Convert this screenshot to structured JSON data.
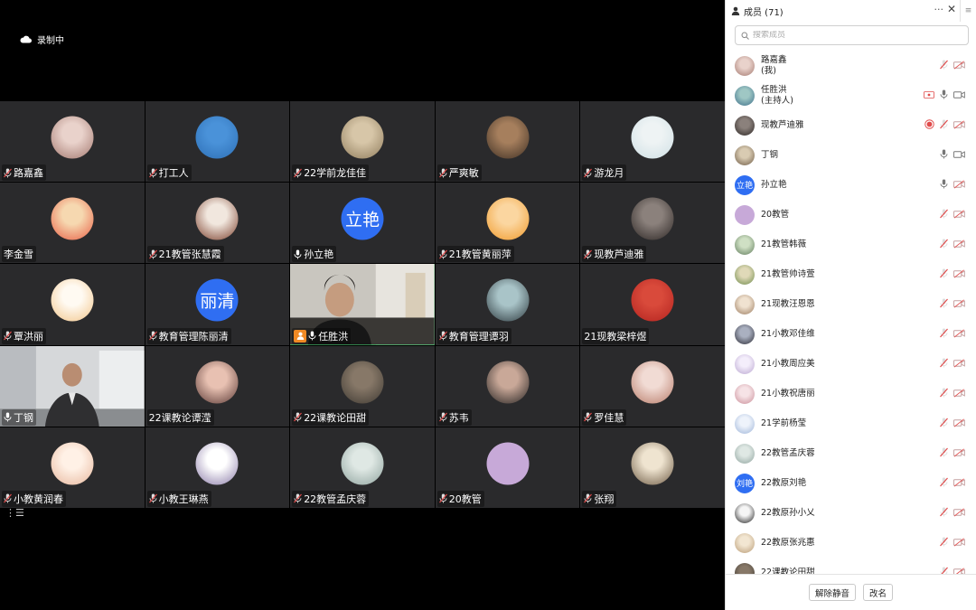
{
  "recording_label": "录制中",
  "grid_tiles": [
    {
      "name": "路嘉鑫",
      "mic": "muted",
      "avatar": {
        "colors": [
          "#a3786f",
          "#e9d2cb"
        ]
      }
    },
    {
      "name": "打工人",
      "mic": "muted",
      "avatar": {
        "colors": [
          "#2d6fb5",
          "#4a92d9"
        ]
      }
    },
    {
      "name": "22学前龙佳佳",
      "mic": "muted",
      "avatar": {
        "colors": [
          "#8f7c5c",
          "#d7c6a8"
        ]
      }
    },
    {
      "name": "严爽敏",
      "mic": "muted",
      "avatar": {
        "colors": [
          "#3f3024",
          "#a67f5d"
        ]
      }
    },
    {
      "name": "游龙月",
      "mic": "muted",
      "avatar": {
        "colors": [
          "#cfe0e5",
          "#eef3f4"
        ]
      }
    },
    {
      "name": "李金雪",
      "mic": "none",
      "avatar": {
        "colors": [
          "#e85f45",
          "#f6d8b0"
        ]
      }
    },
    {
      "name": "21教管张慧霞",
      "mic": "muted",
      "avatar": {
        "colors": [
          "#7b3f2c",
          "#f1e7de"
        ]
      }
    },
    {
      "name": "孙立艳",
      "mic": "on",
      "avatar": {
        "text": "立艳"
      }
    },
    {
      "name": "21教管黄丽萍",
      "mic": "muted",
      "avatar": {
        "colors": [
          "#f09a2b",
          "#fbd6a0"
        ]
      }
    },
    {
      "name": "现教芦迪雅",
      "mic": "muted",
      "avatar": {
        "colors": [
          "#2c2624",
          "#8b817c"
        ]
      }
    },
    {
      "name": "覃洪丽",
      "mic": "muted",
      "avatar": {
        "colors": [
          "#f2c58a",
          "#fffaf2"
        ]
      }
    },
    {
      "name": "教育管理陈丽清",
      "mic": "muted",
      "avatar": {
        "text": "丽清"
      }
    },
    {
      "name": "任胜洪",
      "mic": "on",
      "video": "host",
      "host_badge": true
    },
    {
      "name": "教育管理谭羽",
      "mic": "muted",
      "avatar": {
        "colors": [
          "#2e3a3f",
          "#a9c4c8"
        ]
      }
    },
    {
      "name": "21现教梁梓煜",
      "mic": "none",
      "avatar": {
        "colors": [
          "#b3231f",
          "#d94a3b"
        ]
      }
    },
    {
      "name": "丁钢",
      "mic": "on",
      "video": "office"
    },
    {
      "name": "22课教论谭滢",
      "mic": "none",
      "avatar": {
        "colors": [
          "#5b3a36",
          "#e8c1b2"
        ]
      }
    },
    {
      "name": "22课教论田甜",
      "mic": "muted",
      "avatar": {
        "colors": [
          "#3f3a33",
          "#877868"
        ]
      }
    },
    {
      "name": "苏韦",
      "mic": "muted",
      "avatar": {
        "colors": [
          "#262322",
          "#c9a898"
        ]
      }
    },
    {
      "name": "罗佳慧",
      "mic": "muted",
      "avatar": {
        "colors": [
          "#b87c6a",
          "#f1dbd4"
        ]
      }
    },
    {
      "name": "小教黄润春",
      "mic": "muted",
      "avatar": {
        "colors": [
          "#e7b79d",
          "#fff1e6"
        ]
      }
    },
    {
      "name": "小教王琳燕",
      "mic": "muted",
      "avatar": {
        "colors": [
          "#8a7aa8",
          "#ffffff"
        ]
      }
    },
    {
      "name": "22教管孟庆蓉",
      "mic": "muted",
      "avatar": {
        "colors": [
          "#8fa39e",
          "#dfe8e4"
        ]
      }
    },
    {
      "name": "20教管",
      "mic": "muted",
      "avatar": {
        "colors": [
          "#c7a9d8",
          "#c7a9d8"
        ]
      }
    },
    {
      "name": "张翔",
      "mic": "muted",
      "avatar": {
        "colors": [
          "#6e5b45",
          "#efe4d0"
        ]
      }
    }
  ],
  "panel": {
    "title": "成员 (71)",
    "more_label": "···",
    "close_label": "✕",
    "menu_label": "≡",
    "search_placeholder": "搜索成员",
    "footer": {
      "unmute_label": "解除静音",
      "rename_label": "改名"
    }
  },
  "members": [
    {
      "name": "路嘉鑫",
      "sub": "(我)",
      "mic": "muted",
      "video": "off",
      "avatar": {
        "colors": [
          "#a3786f",
          "#e9d2cb"
        ]
      }
    },
    {
      "name": "任胜洪",
      "sub": "(主持人)",
      "mic": "on",
      "video": "on",
      "share": true,
      "avatar": {
        "colors": [
          "#3d6f8a",
          "#9fc7c4"
        ]
      }
    },
    {
      "name": "现教芦迪雅",
      "mic": "muted",
      "video": "off",
      "record": true,
      "avatar": {
        "colors": [
          "#2c2624",
          "#8b817c"
        ]
      }
    },
    {
      "name": "丁钢",
      "mic": "on",
      "video": "on",
      "avatar": {
        "colors": [
          "#6d5a45",
          "#d9cbb2"
        ]
      }
    },
    {
      "name": "孙立艳",
      "mic": "on",
      "video": "off",
      "avatar": {
        "text": "立艳"
      }
    },
    {
      "name": "20教管",
      "mic": "muted",
      "video": "off",
      "avatar": {
        "colors": [
          "#c7a9d8",
          "#c7a9d8"
        ]
      }
    },
    {
      "name": "21教管韩薇",
      "mic": "muted",
      "video": "off",
      "avatar": {
        "colors": [
          "#5f7a5b",
          "#cfe0c4"
        ]
      }
    },
    {
      "name": "21教管帅诗萱",
      "mic": "muted",
      "video": "off",
      "avatar": {
        "colors": [
          "#6d8a4a",
          "#e0d9b8"
        ]
      }
    },
    {
      "name": "21现教汪恩恩",
      "mic": "muted",
      "video": "off",
      "avatar": {
        "colors": [
          "#9a7a5e",
          "#f0e2d0"
        ]
      }
    },
    {
      "name": "21小教邓佳维",
      "mic": "muted",
      "video": "off",
      "avatar": {
        "colors": [
          "#2a2a34",
          "#aab0c0"
        ]
      }
    },
    {
      "name": "21小教周应美",
      "mic": "muted",
      "video": "off",
      "avatar": {
        "colors": [
          "#b9a6d0",
          "#f4eefb"
        ]
      }
    },
    {
      "name": "21小教祝唐丽",
      "mic": "muted",
      "video": "off",
      "avatar": {
        "colors": [
          "#c98d98",
          "#f6e3e6"
        ]
      }
    },
    {
      "name": "21学前杨莹",
      "mic": "muted",
      "video": "off",
      "avatar": {
        "colors": [
          "#9db4d8",
          "#eef3fb"
        ]
      }
    },
    {
      "name": "22教管孟庆蓉",
      "mic": "muted",
      "video": "off",
      "avatar": {
        "colors": [
          "#8fa39e",
          "#dfe8e4"
        ]
      }
    },
    {
      "name": "22教原刘艳",
      "mic": "muted",
      "video": "off",
      "avatar": {
        "text": "刘艳"
      }
    },
    {
      "name": "22教原孙小乂",
      "mic": "muted",
      "video": "off",
      "avatar": {
        "colors": [
          "#1e1e1e",
          "#f5f5f5"
        ]
      }
    },
    {
      "name": "22教原张兆惠",
      "mic": "muted",
      "video": "off",
      "avatar": {
        "colors": [
          "#b89a74",
          "#f2e6d2"
        ]
      }
    },
    {
      "name": "22课教论田甜",
      "mic": "muted",
      "video": "off",
      "avatar": {
        "colors": [
          "#3f3a33",
          "#877868"
        ]
      }
    }
  ],
  "colors": {
    "muted": "#e04b4b",
    "mic_on": "#777777",
    "active_border": "#2fb35a",
    "accent_blue": "#2f6ef2"
  }
}
